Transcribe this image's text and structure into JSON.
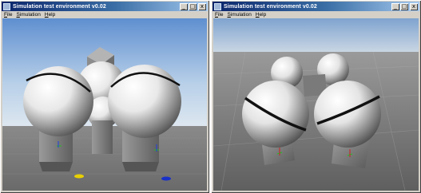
{
  "windows": [
    {
      "title": "Simulation test environment v0.02",
      "menu": [
        {
          "label": "File",
          "underline": "F",
          "rest": "ile"
        },
        {
          "label": "Simulation",
          "underline": "S",
          "rest": "imulation"
        },
        {
          "label": "Help",
          "underline": "H",
          "rest": "elp"
        }
      ],
      "buttons": {
        "minimize": "_",
        "maximize": "□",
        "close": "x"
      }
    },
    {
      "title": "Simulation test environment v0.02",
      "menu": [
        {
          "label": "File",
          "underline": "F",
          "rest": "ile"
        },
        {
          "label": "Simulation",
          "underline": "S",
          "rest": "imulation"
        },
        {
          "label": "Help",
          "underline": "H",
          "rest": "elp"
        }
      ],
      "buttons": {
        "minimize": "_",
        "maximize": "□",
        "close": "x"
      }
    }
  ],
  "colors": {
    "titlebar_start": "#0a246a",
    "titlebar_end": "#a6caf0",
    "window_face": "#d4d0c8",
    "sky_top": "#6f9fd8",
    "ground": "#7d7d7d",
    "sphere_light": "#ffffff",
    "sphere_dark": "#6e6e6e"
  }
}
